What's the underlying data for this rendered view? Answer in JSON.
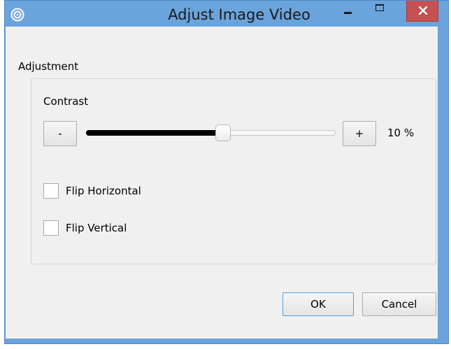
{
  "window": {
    "title": "Adjust Image Video",
    "icon": "target-icon",
    "controls": [
      "minimize-icon",
      "maximize-icon",
      "close-icon"
    ]
  },
  "adjustment": {
    "group_label": "Adjustment",
    "contrast_label": "Contrast",
    "decrease_label": "-",
    "increase_label": "+",
    "value_text": "10 %",
    "slider_level": 0.55
  },
  "options": {
    "flip_horizontal": {
      "label": "Flip Horizontal",
      "checked": false
    },
    "flip_vertical": {
      "label": "Flip Vertical",
      "checked": false
    }
  },
  "buttons": {
    "ok": "OK",
    "cancel": "Cancel"
  }
}
